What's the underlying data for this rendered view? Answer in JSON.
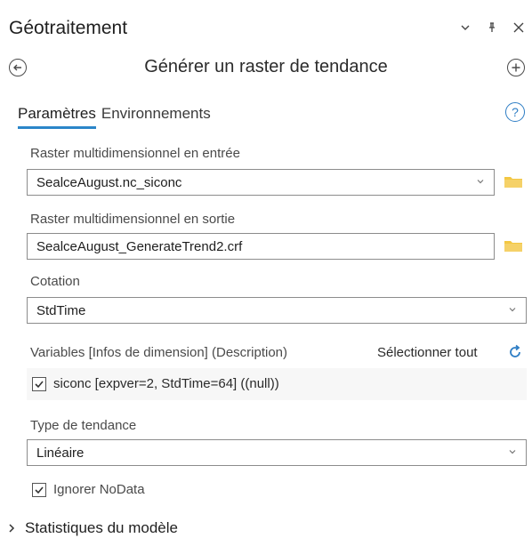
{
  "pane": {
    "title": "Géotraitement",
    "controls": {
      "dropdown_icon": "chevron-down-icon",
      "pin_icon": "pin-icon",
      "close_icon": "close-icon"
    }
  },
  "tool": {
    "title": "Générer un raster de tendance",
    "back_icon": "back-arrow-icon",
    "add_icon": "add-icon"
  },
  "tabs": [
    {
      "label": "Paramètres",
      "active": true
    },
    {
      "label": "Environnements",
      "active": false
    }
  ],
  "help_icon": "help-icon",
  "params": {
    "input_raster": {
      "label": "Raster multidimensionnel en entrée",
      "value": "SealceAugust.nc_siconc"
    },
    "output_raster": {
      "label": "Raster multidimensionnel en sortie",
      "value": "SealceAugust_GenerateTrend2.crf"
    },
    "dimension": {
      "label": "Cotation",
      "value": "StdTime"
    },
    "variables": {
      "label": "Variables [Infos de dimension] (Description)",
      "select_all": "Sélectionner tout",
      "items": [
        {
          "label": "siconc [expver=2, StdTime=64] ((null))",
          "checked": true
        }
      ]
    },
    "trend_type": {
      "label": "Type de tendance",
      "value": "Linéaire"
    },
    "ignore_nodata": {
      "label": "Ignorer NoData",
      "checked": true
    }
  },
  "sections": [
    {
      "label": "Statistiques du modèle",
      "expanded": false
    }
  ],
  "colors": {
    "accent": "#2b86c9",
    "folder": "#f3c743"
  }
}
